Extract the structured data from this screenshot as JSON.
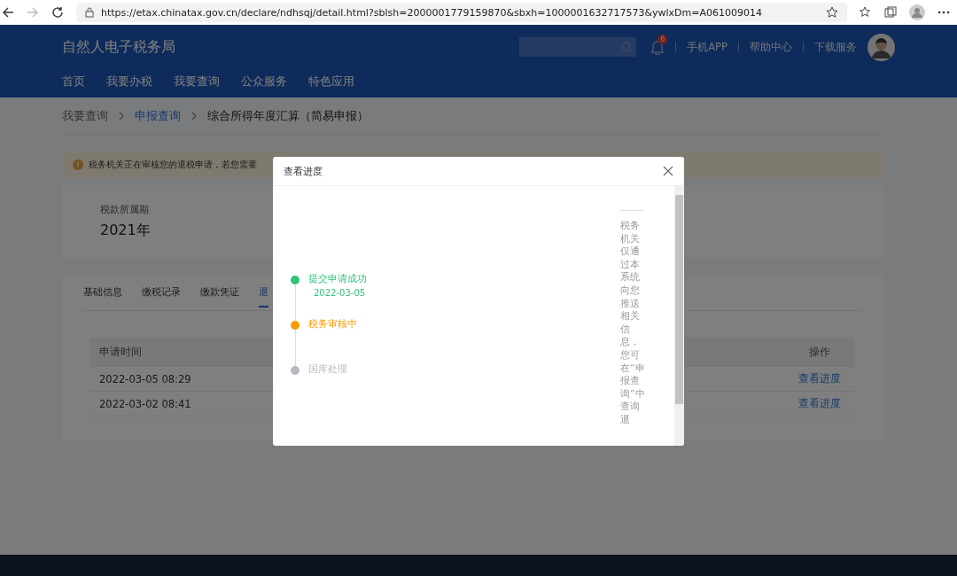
{
  "browser": {
    "url": "https://etax.chinatax.gov.cn/declare/ndhsqj/detail.html?sblsh=2000001779159870&sbxh=1000001632717573&ywlxDm=A061009014"
  },
  "header": {
    "title": "自然人电子税务局",
    "notification_count": "6",
    "links": [
      "手机APP",
      "帮助中心",
      "下载服务"
    ],
    "nav": [
      {
        "label": "首页",
        "selected": false
      },
      {
        "label": "我要办税",
        "selected": false
      },
      {
        "label": "我要查询",
        "selected": false
      },
      {
        "label": "公众服务",
        "selected": false
      },
      {
        "label": "特色应用",
        "selected": false
      }
    ]
  },
  "breadcrumb": [
    {
      "label": "我要查询",
      "kind": "plain"
    },
    {
      "label": "申报查询",
      "kind": "link"
    },
    {
      "label": "综合所得年度汇算（简易申报）",
      "kind": "current"
    }
  ],
  "alert": {
    "text": "税务机关正在审核您的退税申请，若您需要"
  },
  "period": {
    "label": "税款所属期",
    "value": "2021年"
  },
  "tabs": [
    {
      "label": "基础信息",
      "selected": false
    },
    {
      "label": "缴税记录",
      "selected": false
    },
    {
      "label": "缴款凭证",
      "selected": false
    },
    {
      "label": "退",
      "selected": true
    }
  ],
  "table": {
    "columns": [
      "申请时间",
      "操作"
    ],
    "rows": [
      {
        "time": "2022-03-05 08:29",
        "action": "查看进度"
      },
      {
        "time": "2022-03-02 08:41",
        "action": "查看进度"
      }
    ]
  },
  "modal": {
    "title": "查看进度",
    "steps": [
      {
        "label": "提交申请成功",
        "date": "2022-03-05",
        "kind": "done"
      },
      {
        "label": "税务审核中",
        "kind": "current"
      },
      {
        "label": "国库处理",
        "kind": "pending"
      }
    ],
    "note": "税务机关仅通过本系统向您推送相关信息，您可在“申报查询”中查询退"
  }
}
